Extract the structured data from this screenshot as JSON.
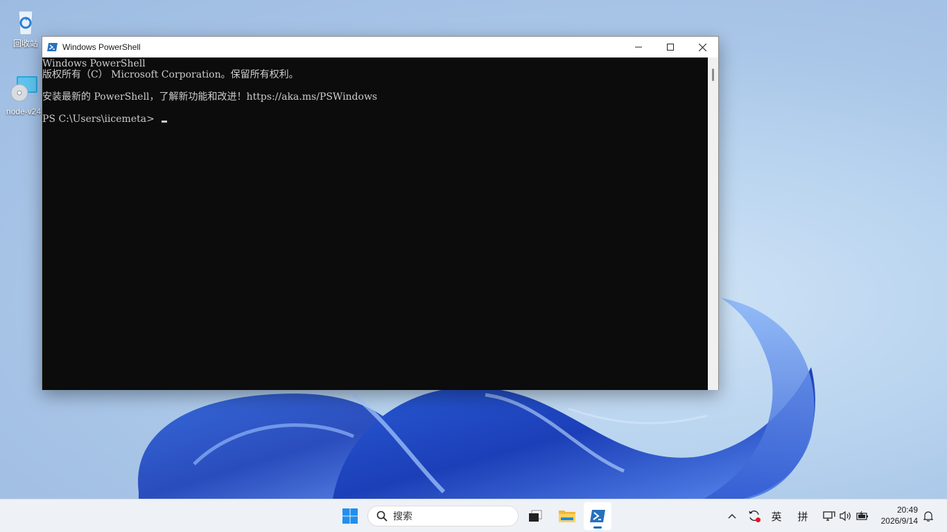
{
  "desktop": {
    "icons": [
      {
        "label": "回收站"
      },
      {
        "label": "node-v24"
      }
    ]
  },
  "window": {
    "title": "Windows PowerShell",
    "console_lines": [
      "Windows PowerShell",
      "版权所有（C） Microsoft Corporation。保留所有权利。",
      "",
      "安装最新的 PowerShell，了解新功能和改进！https://aka.ms/PSWindows",
      "",
      "PS C:\\Users\\iicemeta> "
    ]
  },
  "taskbar": {
    "search_placeholder": "搜索",
    "ime_mode": "英",
    "ime_pinyin": "拼",
    "clock_time": "20:49",
    "clock_date": "2026/9/14"
  },
  "colors": {
    "console_bg": "#0c0c0c",
    "console_fg": "#cccccc",
    "accent": "#0067c0"
  }
}
